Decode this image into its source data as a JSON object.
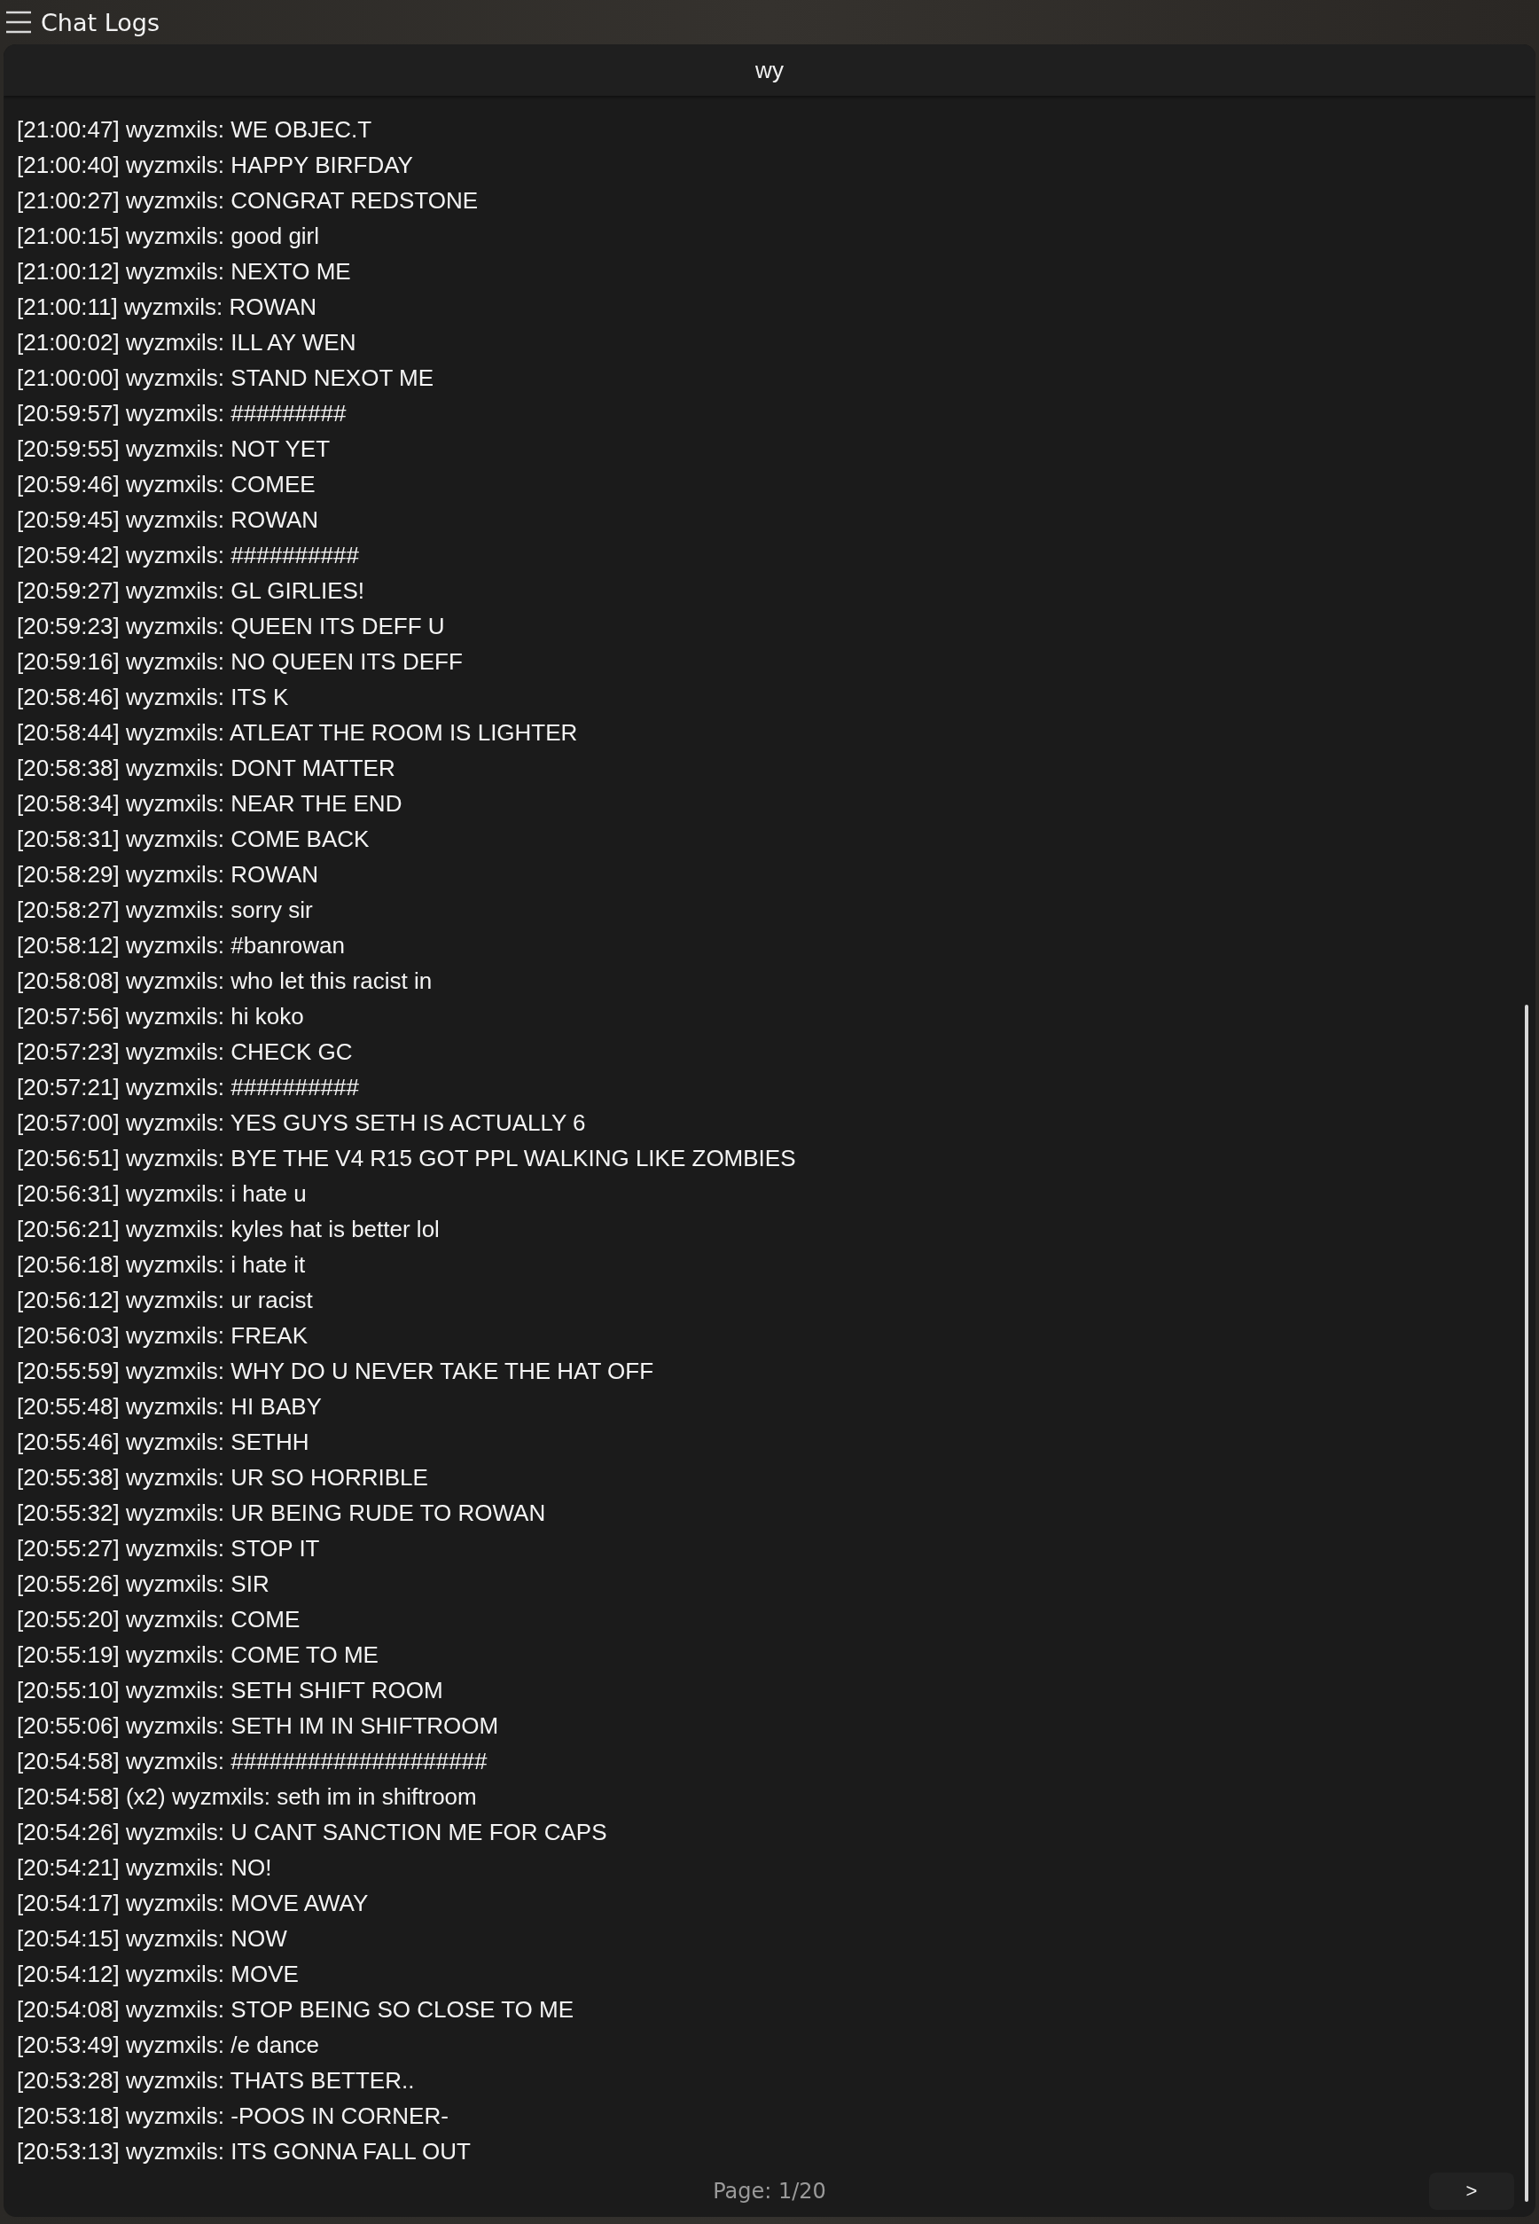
{
  "header": {
    "title": "Chat Logs"
  },
  "search": {
    "value": "wy"
  },
  "log": [
    "[21:00:47] wyzmxils: WE OBJEC.T",
    "[21:00:40] wyzmxils: HAPPY BIRFDAY",
    "[21:00:27] wyzmxils: CONGRAT REDSTONE",
    "[21:00:15] wyzmxils: good girl",
    "[21:00:12] wyzmxils: NEXTO ME",
    "[21:00:11] wyzmxils: ROWAN",
    "[21:00:02] wyzmxils: ILL AY WEN",
    "[21:00:00] wyzmxils: STAND NEXOT ME",
    "[20:59:57] wyzmxils: #########",
    "[20:59:55] wyzmxils: NOT YET",
    "[20:59:46] wyzmxils: COMEE",
    "[20:59:45] wyzmxils: ROWAN",
    "[20:59:42] wyzmxils: ##########",
    "[20:59:27] wyzmxils: GL GIRLIES!",
    "[20:59:23] wyzmxils: QUEEN ITS DEFF U",
    "[20:59:16] wyzmxils: NO QUEEN ITS DEFF",
    "[20:58:46] wyzmxils: ITS K",
    "[20:58:44] wyzmxils: ATLEAT THE ROOM IS LIGHTER",
    "[20:58:38] wyzmxils: DONT MATTER",
    "[20:58:34] wyzmxils: NEAR THE END",
    "[20:58:31] wyzmxils: COME BACK",
    "[20:58:29] wyzmxils: ROWAN",
    "[20:58:27] wyzmxils: sorry sir",
    "[20:58:12] wyzmxils: #banrowan",
    "[20:58:08] wyzmxils: who let this racist in",
    "[20:57:56] wyzmxils: hi koko",
    "[20:57:23] wyzmxils: CHECK GC",
    "[20:57:21] wyzmxils: ##########",
    "[20:57:00] wyzmxils: YES GUYS SETH IS ACTUALLY 6",
    "[20:56:51] wyzmxils: BYE THE V4 R15 GOT PPL WALKING LIKE ZOMBIES",
    "[20:56:31] wyzmxils: i hate u",
    "[20:56:21] wyzmxils: kyles hat is better lol",
    "[20:56:18] wyzmxils: i hate it",
    "[20:56:12] wyzmxils: ur racist",
    "[20:56:03] wyzmxils: FREAK",
    "[20:55:59] wyzmxils: WHY DO U NEVER TAKE THE HAT OFF",
    "[20:55:48] wyzmxils: HI BABY",
    "[20:55:46] wyzmxils: SETHH",
    "[20:55:38] wyzmxils: UR SO HORRIBLE",
    "[20:55:32] wyzmxils: UR BEING RUDE TO ROWAN",
    "[20:55:27] wyzmxils: STOP IT",
    "[20:55:26] wyzmxils: SIR",
    "[20:55:20] wyzmxils: COME",
    "[20:55:19] wyzmxils: COME TO ME",
    "[20:55:10] wyzmxils: SETH SHIFT ROOM",
    "[20:55:06] wyzmxils: SETH IM IN SHIFTROOM",
    "[20:54:58] wyzmxils: ####################",
    "[20:54:58] (x2) wyzmxils: seth im in shiftroom",
    "[20:54:26] wyzmxils: U CANT SANCTION ME FOR CAPS",
    "[20:54:21] wyzmxils: NO!",
    "[20:54:17] wyzmxils: MOVE AWAY",
    "[20:54:15] wyzmxils: NOW",
    "[20:54:12] wyzmxils: MOVE",
    "[20:54:08] wyzmxils: STOP BEING SO CLOSE TO ME",
    "[20:53:49] wyzmxils: /e dance",
    "[20:53:28] wyzmxils: THATS BETTER..",
    "[20:53:18] wyzmxils: -POOS IN CORNER-",
    "[20:53:13] wyzmxils: ITS GONNA FALL OUT"
  ],
  "footer": {
    "page": "Page: 1/20",
    "next_button": ">"
  }
}
